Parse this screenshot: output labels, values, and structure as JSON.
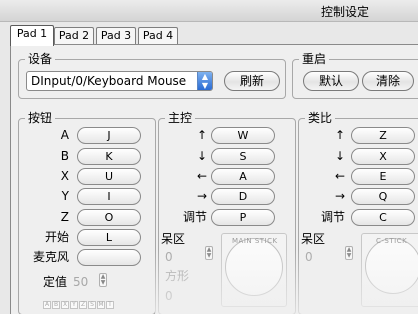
{
  "window": {
    "title": "控制设定"
  },
  "tabs": [
    "Pad 1",
    "Pad 2",
    "Pad 3",
    "Pad 4"
  ],
  "device": {
    "label": "设备",
    "selected": "DInput/0/Keyboard Mouse",
    "refresh": "刷新"
  },
  "reset": {
    "label": "重启",
    "default": "默认",
    "clear": "清除"
  },
  "buttons": {
    "label": "按钮",
    "rows": [
      {
        "name": "A",
        "key": "J"
      },
      {
        "name": "B",
        "key": "K"
      },
      {
        "name": "X",
        "key": "U"
      },
      {
        "name": "Y",
        "key": "I"
      },
      {
        "name": "Z",
        "key": "O"
      },
      {
        "name": "开始",
        "key": "L"
      },
      {
        "name": "麦克风",
        "key": ""
      }
    ],
    "threshold_label": "定值",
    "threshold_value": "50",
    "meter_letters": [
      "A",
      "B",
      "X",
      "Y",
      "Z",
      "S",
      "M",
      "T"
    ]
  },
  "main_stick": {
    "label": "主控",
    "rows": [
      {
        "name": "↑",
        "key": "W"
      },
      {
        "name": "↓",
        "key": "S"
      },
      {
        "name": "←",
        "key": "A"
      },
      {
        "name": "→",
        "key": "D"
      },
      {
        "name": "调节",
        "key": "P"
      }
    ],
    "dead_zone_label": "呆区",
    "dead_zone_value": "0",
    "shape_label": "方形",
    "shape_value": "0",
    "canvas_label": "MAIN STICK"
  },
  "c_stick": {
    "label": "类比",
    "rows": [
      {
        "name": "↑",
        "key": "Z"
      },
      {
        "name": "↓",
        "key": "X"
      },
      {
        "name": "←",
        "key": "E"
      },
      {
        "name": "→",
        "key": "Q"
      },
      {
        "name": "调节",
        "key": "C"
      }
    ],
    "dead_zone_label": "呆区",
    "dead_zone_value": "0",
    "canvas_label": "C-STICK"
  }
}
